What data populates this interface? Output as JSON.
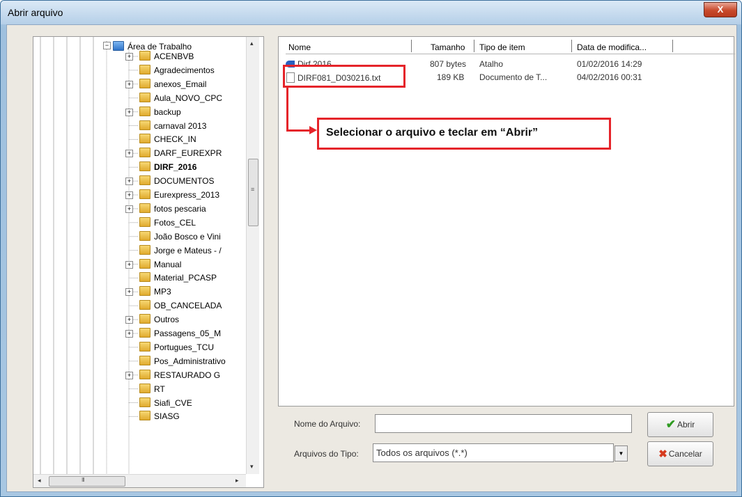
{
  "window": {
    "title": "Abrir arquivo",
    "close_glyph": "X"
  },
  "tree": {
    "root_label": "Área de Trabalho",
    "items": [
      {
        "label": "ACENBVB",
        "expandable": true
      },
      {
        "label": "Agradecimentos",
        "expandable": false
      },
      {
        "label": "anexos_Email",
        "expandable": true
      },
      {
        "label": "Aula_NOVO_CPC",
        "expandable": false
      },
      {
        "label": "backup",
        "expandable": true
      },
      {
        "label": "carnaval 2013",
        "expandable": false
      },
      {
        "label": "CHECK_IN",
        "expandable": false
      },
      {
        "label": "DARF_EUREXPR",
        "expandable": true
      },
      {
        "label": "DIRF_2016",
        "expandable": false,
        "bold": true
      },
      {
        "label": "DOCUMENTOS",
        "expandable": true
      },
      {
        "label": "Eurexpress_2013",
        "expandable": true
      },
      {
        "label": "fotos pescaria",
        "expandable": true
      },
      {
        "label": "Fotos_CEL",
        "expandable": false
      },
      {
        "label": "João Bosco e Vini",
        "expandable": false
      },
      {
        "label": "Jorge e Mateus - /",
        "expandable": false
      },
      {
        "label": "Manual",
        "expandable": true
      },
      {
        "label": "Material_PCASP",
        "expandable": false
      },
      {
        "label": "MP3",
        "expandable": true
      },
      {
        "label": "OB_CANCELADA",
        "expandable": false
      },
      {
        "label": "Outros",
        "expandable": true
      },
      {
        "label": "Passagens_05_M",
        "expandable": true
      },
      {
        "label": "Portugues_TCU",
        "expandable": false
      },
      {
        "label": "Pos_Administrativo",
        "expandable": false
      },
      {
        "label": "RESTAURADO G",
        "expandable": true
      },
      {
        "label": "RT",
        "expandable": false
      },
      {
        "label": "Siafi_CVE",
        "expandable": false
      },
      {
        "label": "SIASG",
        "expandable": false
      }
    ],
    "scroll_left": "◂",
    "scroll_right": "▸",
    "scroll_up": "▴",
    "scroll_down": "▾",
    "hthumb_grip": "III",
    "vthumb_grip": "≡"
  },
  "file_list": {
    "columns": [
      "Nome",
      "Tamanho",
      "Tipo de item",
      "Data de modifica..."
    ],
    "rows": [
      {
        "name": "Dirf 2016",
        "size": "807 bytes",
        "type": "Atalho",
        "date": "01/02/2016 14:29",
        "icon": "shortcut-icon"
      },
      {
        "name": "DIRF081_D030216.txt",
        "size": "189 KB",
        "type": "Documento de T...",
        "date": "04/02/2016 00:31",
        "icon": "text-file-icon"
      }
    ]
  },
  "annotation": {
    "callout_text": "Selecionar o arquivo e teclar em “Abrir”",
    "color": "#e5242a"
  },
  "form": {
    "filename_label": "Nome do Arquivo:",
    "filename_value": "",
    "filetype_label": "Arquivos do Tipo:",
    "filetype_value": "Todos os arquivos (*.*)",
    "combo_arrow": "▼"
  },
  "buttons": {
    "open_label": "Abrir",
    "cancel_label": "Cancelar",
    "open_icon": "✔",
    "cancel_icon": "✖"
  }
}
